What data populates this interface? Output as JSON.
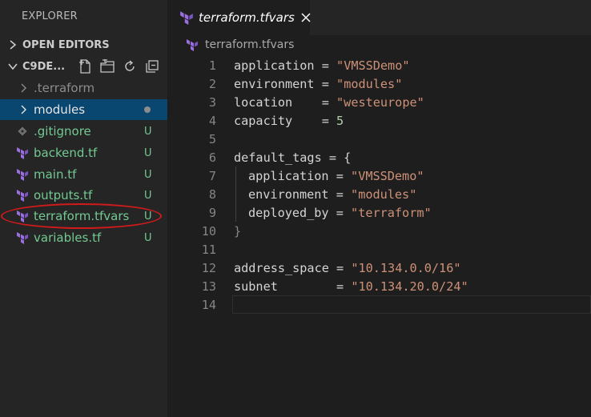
{
  "explorer": {
    "title": "EXPLORER",
    "open_editors_label": "OPEN EDITORS",
    "folder_label": "C9DE...",
    "toolbar_icons": [
      "new-file-icon",
      "new-folder-icon",
      "refresh-icon",
      "collapse-all-icon"
    ],
    "files": [
      {
        "name": ".terraform",
        "type": "folder",
        "status": "",
        "color": "#8c8c8c"
      },
      {
        "name": "modules",
        "type": "folder",
        "status": "dot",
        "selected": true
      },
      {
        "name": ".gitignore",
        "type": "file",
        "status": "U",
        "icon": "gitignore-icon"
      },
      {
        "name": "backend.tf",
        "type": "file",
        "status": "U",
        "icon": "terraform-icon"
      },
      {
        "name": "main.tf",
        "type": "file",
        "status": "U",
        "icon": "terraform-icon"
      },
      {
        "name": "outputs.tf",
        "type": "file",
        "status": "U",
        "icon": "terraform-icon"
      },
      {
        "name": "terraform.tfvars",
        "type": "file",
        "status": "U",
        "icon": "terraform-icon",
        "highlighted": true
      },
      {
        "name": "variables.tf",
        "type": "file",
        "status": "U",
        "icon": "terraform-icon"
      }
    ]
  },
  "editor": {
    "tab_label": "terraform.tfvars",
    "breadcrumb": "terraform.tfvars",
    "lines": [
      {
        "n": "1",
        "key": "application",
        "pad": " ",
        "value": "\"VMSSDemo\""
      },
      {
        "n": "2",
        "key": "environment",
        "pad": " ",
        "value": "\"modules\""
      },
      {
        "n": "3",
        "key": "location",
        "pad": "    ",
        "value": "\"westeurope\""
      },
      {
        "n": "4",
        "key": "capacity",
        "pad": "    ",
        "value": "5"
      },
      {
        "n": "5"
      },
      {
        "n": "6",
        "text": "default_tags = {"
      },
      {
        "n": "7",
        "key": "application",
        "pad": " ",
        "value": "\"VMSSDemo\"",
        "indent": true
      },
      {
        "n": "8",
        "key": "environment",
        "pad": " ",
        "value": "\"modules\"",
        "indent": true
      },
      {
        "n": "9",
        "key": "deployed_by",
        "pad": " ",
        "value": "\"terraform\"",
        "indent": true
      },
      {
        "n": "10",
        "text": "}"
      },
      {
        "n": "11"
      },
      {
        "n": "12",
        "key": "address_space",
        "pad": " ",
        "value": "\"10.134.0.0/16\""
      },
      {
        "n": "13",
        "key": "subnet",
        "pad": "        ",
        "value": "\"10.134.20.0/24\""
      },
      {
        "n": "14"
      }
    ]
  },
  "colors": {
    "string": "#ce9178",
    "number": "#b5cea8",
    "untracked": "#73c991",
    "selection": "#094771",
    "annotation": "#d11a1a",
    "terraform": "#9b6fe0"
  }
}
